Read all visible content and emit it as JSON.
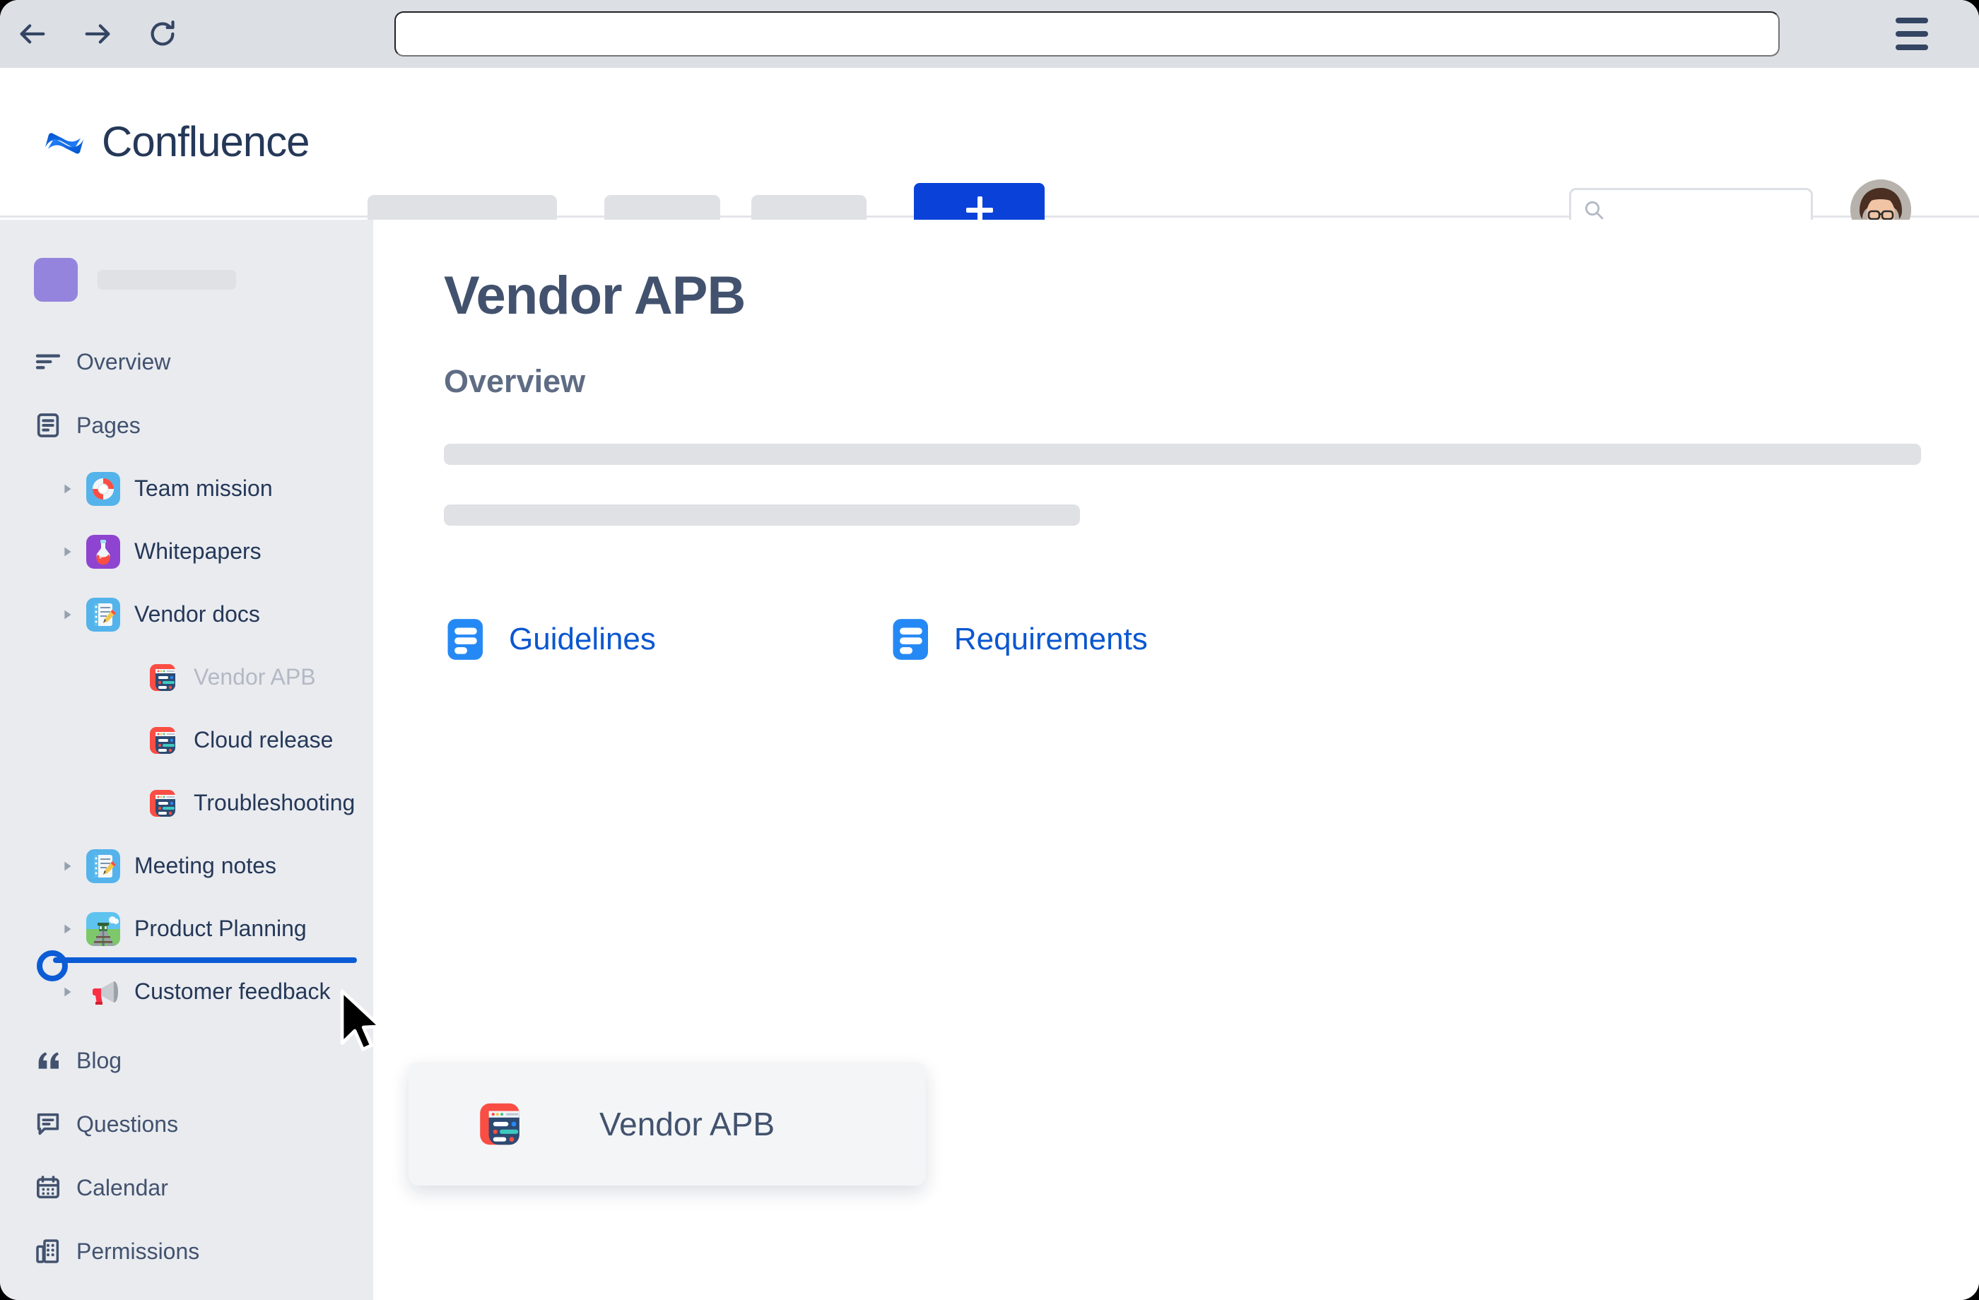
{
  "browser": {
    "back_icon": "arrow-left-icon",
    "forward_icon": "arrow-right-icon",
    "reload_icon": "reload-icon",
    "url_value": "",
    "url_placeholder": "",
    "menu_icon": "hamburger-menu-icon"
  },
  "header": {
    "product_name": "Confluence",
    "logo_icon": "confluence-logo-icon",
    "nav_placeholders": 3,
    "create_label": "+",
    "create_icon": "plus-icon",
    "create_color": "#0a42d9",
    "search": {
      "value": "",
      "placeholder": "",
      "icon": "search-icon"
    },
    "avatar_icon": "user-avatar-photo"
  },
  "sidebar": {
    "space_avatar_color": "#9584dd",
    "space_name_placeholder": "",
    "nav": [
      {
        "label": "Overview",
        "icon": "overview-lines-icon"
      },
      {
        "label": "Pages",
        "icon": "pages-document-icon"
      }
    ],
    "tree": [
      {
        "label": "Team mission",
        "icon": "lifebuoy-emoji",
        "depth": 1,
        "caret": true,
        "dragging": false
      },
      {
        "label": "Whitepapers",
        "icon": "potion-emoji",
        "depth": 1,
        "caret": true,
        "dragging": false
      },
      {
        "label": "Vendor docs",
        "icon": "memo-emoji",
        "depth": 1,
        "caret": true,
        "dragging": false
      },
      {
        "label": "Vendor APB",
        "icon": "newspaper-emoji",
        "depth": 2,
        "caret": false,
        "dragging": true
      },
      {
        "label": "Cloud release",
        "icon": "newspaper-emoji",
        "depth": 2,
        "caret": false,
        "dragging": false
      },
      {
        "label": "Troubleshooting",
        "icon": "newspaper-emoji",
        "depth": 2,
        "caret": false,
        "dragging": false
      },
      {
        "label": "Meeting notes",
        "icon": "memo-emoji",
        "depth": 1,
        "caret": true,
        "dragging": false
      },
      {
        "label": "Product Planning",
        "icon": "railway-track-emoji",
        "depth": 1,
        "caret": true,
        "dragging": false
      },
      {
        "label": "Customer feedback",
        "icon": "megaphone-emoji",
        "depth": 1,
        "caret": true,
        "dragging": false
      }
    ],
    "drop_indicator": {
      "after_label": "Product Planning",
      "before_label": "Customer feedback",
      "color": "#0b5cd5"
    },
    "footer_nav": [
      {
        "label": "Blog",
        "icon": "quote-icon"
      },
      {
        "label": "Questions",
        "icon": "speech-bubble-icon"
      },
      {
        "label": "Calendar",
        "icon": "calendar-icon"
      },
      {
        "label": "Permissions",
        "icon": "building-icon"
      }
    ]
  },
  "main": {
    "page_title": "Vendor APB",
    "section_title": "Overview",
    "body_placeholders": [
      "",
      ""
    ],
    "links": [
      {
        "label": "Guidelines",
        "icon": "page-link-icon",
        "color": "#0b57d0"
      },
      {
        "label": "Requirements",
        "icon": "page-link-icon",
        "color": "#0b57d0"
      }
    ]
  },
  "drag_preview": {
    "label": "Vendor APB",
    "icon": "newspaper-emoji"
  },
  "cursor": {
    "icon": "mouse-pointer-cursor"
  }
}
